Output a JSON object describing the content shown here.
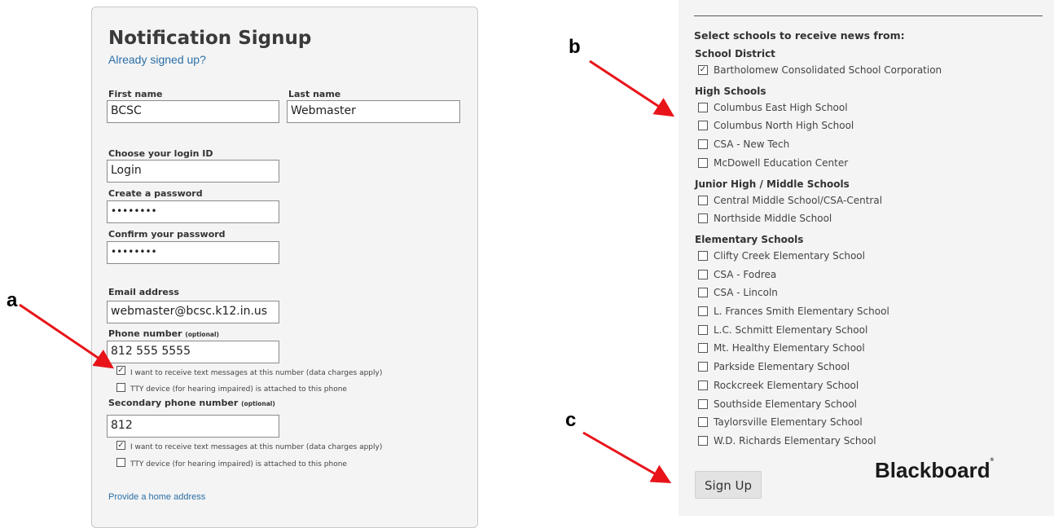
{
  "form": {
    "title": "Notification Signup",
    "already_link": "Already signed up?",
    "first_name_label": "First name",
    "first_name_value": "BCSC",
    "last_name_label": "Last name",
    "last_name_value": "Webmaster",
    "login_label": "Choose your login ID",
    "login_value": "Login",
    "password_label": "Create a password",
    "password_value": "••••••••",
    "confirm_label": "Confirm your password",
    "confirm_value": "••••••••",
    "email_label": "Email address",
    "email_value": "webmaster@bcsc.k12.in.us",
    "phone_label": "Phone number",
    "optional_tag": "(optional)",
    "phone_value": "812 555 5555",
    "text_msg_label": "I want to receive text messages at this number (data charges apply)",
    "tty_label": "TTY device (for hearing impaired) is attached to this phone",
    "secondary_phone_label": "Secondary phone number",
    "secondary_phone_value": "812",
    "home_address_link": "Provide a home address",
    "check_mark": "✓"
  },
  "schools": {
    "heading": "Select schools to receive news from:",
    "groups": [
      {
        "name": "School District",
        "items": [
          "Bartholomew Consolidated School Corporation"
        ]
      },
      {
        "name": "High Schools",
        "items": [
          "Columbus East High School",
          "Columbus North High School",
          "CSA - New Tech",
          "McDowell Education Center"
        ]
      },
      {
        "name": "Junior High / Middle Schools",
        "items": [
          "Central Middle School/CSA-Central",
          "Northside Middle School"
        ]
      },
      {
        "name": "Elementary Schools",
        "items": [
          "Clifty Creek Elementary School",
          "CSA - Fodrea",
          "CSA - Lincoln",
          "L. Frances Smith Elementary School",
          "L.C. Schmitt Elementary School",
          "Mt. Healthy Elementary School",
          "Parkside Elementary School",
          "Rockcreek Elementary School",
          "Southside Elementary School",
          "Taylorsville Elementary School",
          "W.D. Richards Elementary School"
        ]
      }
    ]
  },
  "signup_button": "Sign Up",
  "brand": "Blackboard",
  "trademark": "®",
  "annotations": {
    "a": "a",
    "b": "b",
    "c": "c"
  },
  "colors": {
    "arrow": "#e8141a",
    "link": "#2a6fa8",
    "panel_bg": "#f4f4f4"
  }
}
